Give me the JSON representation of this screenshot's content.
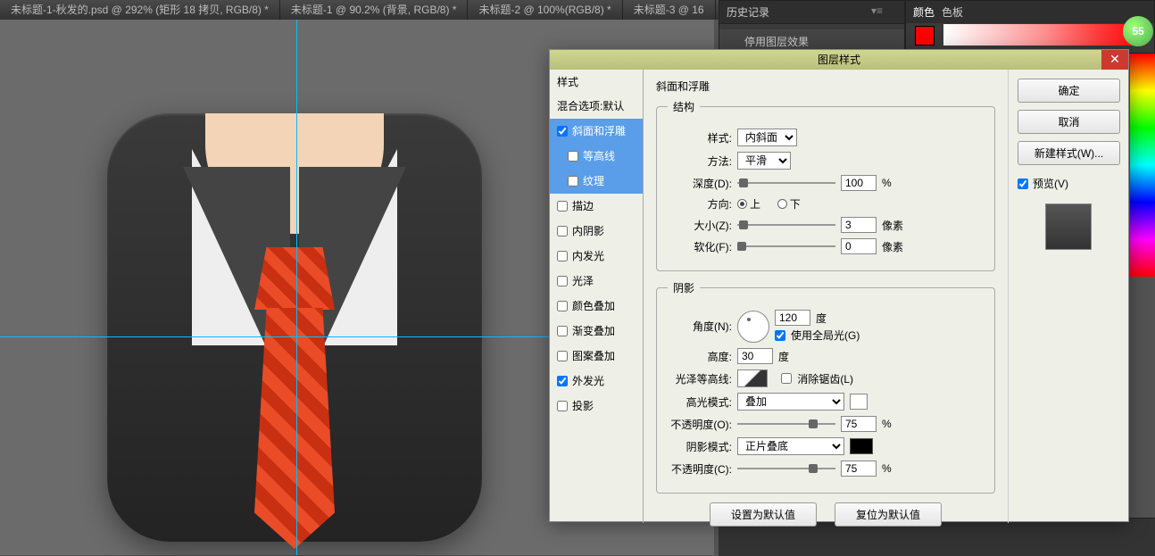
{
  "tabs": [
    "未标题-1-秋发的.psd @ 292% (矩形 18 拷贝, RGB/8) *",
    "未标题-1 @ 90.2% (背景, RGB/8) *",
    "未标题-2 @ 100%(RGB/8) *",
    "未标题-3 @ 16"
  ],
  "history": {
    "title": "历史记录",
    "entry": "停用图层效果"
  },
  "color": {
    "tab1": "颜色",
    "tab2": "色板",
    "badge": "55"
  },
  "dialog": {
    "title": "图层样式",
    "styles_header": "样式",
    "blend": "混合选项:默认",
    "items": {
      "bevel": "斜面和浮雕",
      "contour": "等高线",
      "texture": "纹理",
      "stroke": "描边",
      "innerShadow": "内阴影",
      "innerGlow": "内发光",
      "satin": "光泽",
      "colorOverlay": "颜色叠加",
      "gradOverlay": "渐变叠加",
      "patOverlay": "图案叠加",
      "outerGlow": "外发光",
      "dropShadow": "投影"
    },
    "section_bevel": "斜面和浮雕",
    "group_structure": "结构",
    "style_lbl": "样式:",
    "style_val": "内斜面",
    "technique_lbl": "方法:",
    "technique_val": "平滑",
    "depth_lbl": "深度(D):",
    "depth_val": "100",
    "pct": "%",
    "direction_lbl": "方向:",
    "dir_up": "上",
    "dir_down": "下",
    "size_lbl": "大小(Z):",
    "size_val": "3",
    "px": "像素",
    "soften_lbl": "软化(F):",
    "soften_val": "0",
    "group_shading": "阴影",
    "angle_lbl": "角度(N):",
    "angle_val": "120",
    "deg": "度",
    "global_light": "使用全局光(G)",
    "altitude_lbl": "高度:",
    "altitude_val": "30",
    "gloss_lbl": "光泽等高线:",
    "antialias": "消除锯齿(L)",
    "hilite_mode_lbl": "高光模式:",
    "hilite_mode_val": "叠加",
    "opacity_lbl": "不透明度(O):",
    "opacity_val": "75",
    "shadow_mode_lbl": "阴影模式:",
    "shadow_mode_val": "正片叠底",
    "opacity2_lbl": "不透明度(C):",
    "opacity2_val": "75",
    "make_default": "设置为默认值",
    "reset_default": "复位为默认值",
    "ok": "确定",
    "cancel": "取消",
    "new_style": "新建样式(W)...",
    "preview": "预览(V)"
  }
}
